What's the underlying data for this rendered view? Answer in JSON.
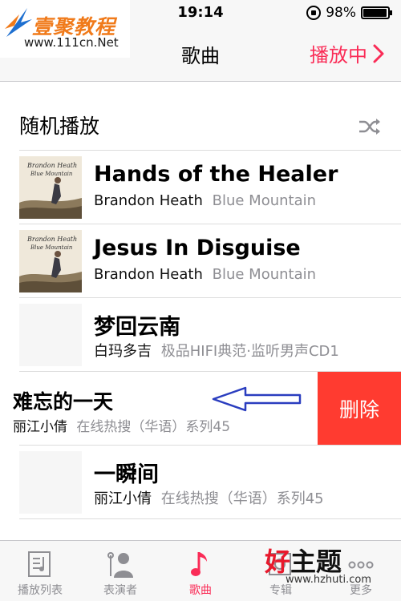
{
  "status_bar": {
    "time": "19:14",
    "battery": "98%",
    "battery_level": 0.98
  },
  "watermark_top": {
    "title": "壹聚教程",
    "url": "www.111cn.Net"
  },
  "nav": {
    "title": "歌曲",
    "now_playing": "播放中"
  },
  "shuffle": {
    "label": "随机播放",
    "icon": "shuffle-icon"
  },
  "songs": [
    {
      "title": "Hands of the Healer",
      "artist": "Brandon Heath",
      "album": "Blue Mountain",
      "artwork": "album-art"
    },
    {
      "title": "Jesus In Disguise",
      "artist": "Brandon Heath",
      "album": "Blue Mountain",
      "artwork": "album-art"
    },
    {
      "title": "梦回云南",
      "artist": "白玛多吉",
      "album": "极品HIFI典范·监听男声CD1",
      "artwork": "blank"
    },
    {
      "title": "难忘的一天",
      "artist": "丽江小倩",
      "album": "在线热搜（华语）系列45",
      "swiped": true,
      "delete_label": "删除"
    },
    {
      "title": "一瞬间",
      "artist": "丽江小倩",
      "album": "在线热搜（华语）系列45",
      "artwork": "blank"
    }
  ],
  "tabs": [
    {
      "label": "播放列表",
      "icon": "playlist-icon",
      "active": false
    },
    {
      "label": "表演者",
      "icon": "artist-icon",
      "active": false
    },
    {
      "label": "歌曲",
      "icon": "music-note-icon",
      "active": true
    },
    {
      "label": "专辑",
      "icon": "album-icon",
      "active": false
    },
    {
      "label": "更多",
      "icon": "more-icon",
      "active": false
    }
  ],
  "watermark_bottom": {
    "hao": "好",
    "zhu": "主题",
    "url": "www.hzhuti.com"
  },
  "colors": {
    "accent": "#fa2c57",
    "delete": "#ff3b30",
    "secondary_text": "#8e8e93",
    "arrow": "#2a3dbf"
  }
}
